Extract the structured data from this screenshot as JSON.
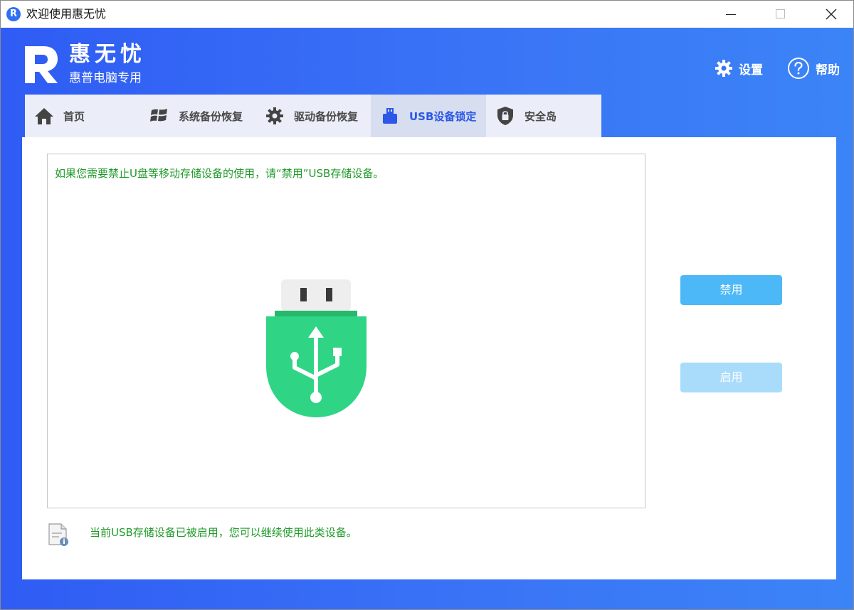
{
  "titlebar": {
    "app_icon_letter": "R",
    "title": "欢迎使用惠无忧"
  },
  "brand": {
    "name": "惠无忧",
    "subtitle": "惠普电脑专用"
  },
  "top_actions": {
    "settings_label": "设置",
    "help_label": "帮助"
  },
  "tabs": [
    {
      "label": "首页",
      "icon": "home-icon"
    },
    {
      "label": "系统备份恢复",
      "icon": "windows-icon"
    },
    {
      "label": "驱动备份恢复",
      "icon": "gear-icon"
    },
    {
      "label": "USB设备锁定",
      "icon": "usb-drive-icon",
      "active": true
    },
    {
      "label": "安全岛",
      "icon": "lock-shield-icon"
    }
  ],
  "content": {
    "message": "如果您需要禁止U盘等移动存储设备的使用，请“禁用”USB存储设备。",
    "disable_label": "禁用",
    "enable_label": "启用",
    "status_text": "当前USB存储设备已被启用，您可以继续使用此类设备。"
  },
  "colors": {
    "header_blue": "#2f5cf4",
    "active_tab_text": "#2c57e8",
    "message_green": "#1f9a28",
    "usb_green": "#2fd585",
    "disable_button": "#4db8f7",
    "enable_button_disabled": "#a9dcfb"
  }
}
